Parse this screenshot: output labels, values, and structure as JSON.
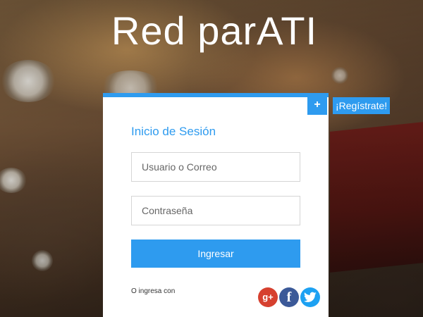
{
  "header": {
    "title": "Red parATI"
  },
  "register": {
    "plus_symbol": "+",
    "label": "¡Regístrate!"
  },
  "login": {
    "heading": "Inicio de Sesión",
    "username_placeholder": "Usuario o Correo",
    "password_placeholder": "Contraseña",
    "submit_label": "Ingresar",
    "alt_label": "O ingresa con"
  },
  "social": [
    {
      "name": "google-plus-icon",
      "glyph": "g+",
      "color": "#d6402f"
    },
    {
      "name": "facebook-icon",
      "glyph": "f",
      "color": "#3b5998"
    },
    {
      "name": "twitter-icon",
      "glyph": "bird",
      "color": "#1da1f2"
    }
  ],
  "colors": {
    "accent": "#2e9bef",
    "card": "#ffffff"
  }
}
